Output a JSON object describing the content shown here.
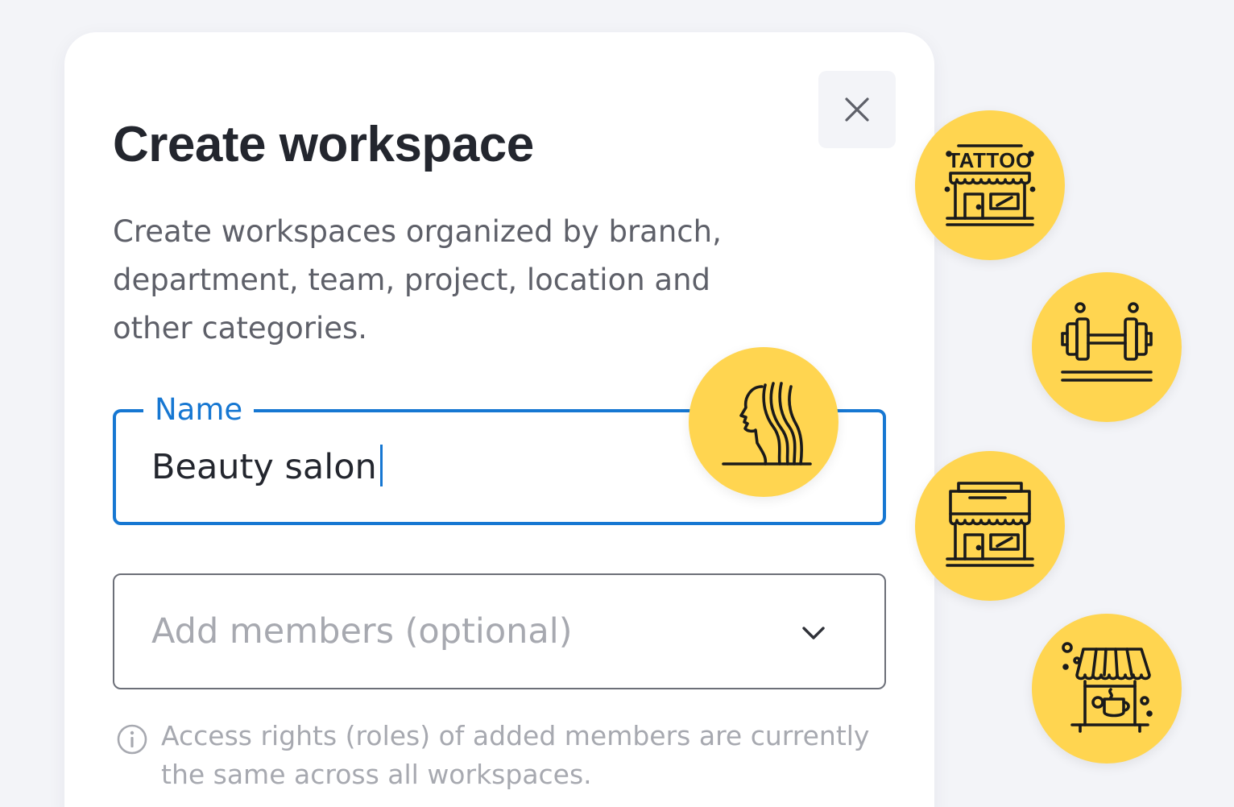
{
  "modal": {
    "title": "Create workspace",
    "description": "Create workspaces organized by branch, department, team, project, location and other categories.",
    "close_icon": "close-icon"
  },
  "name_field": {
    "label": "Name",
    "value": "Beauty salon",
    "focused": true
  },
  "members_field": {
    "placeholder": "Add members (optional)",
    "icon": "chevron-down-icon"
  },
  "hint": {
    "icon": "info-icon",
    "text": "Access rights (roles) of added members are currently the same across all workspaces."
  },
  "category_icons": {
    "tattoo_label": "TATTOO",
    "items": [
      "beauty-salon-icon",
      "tattoo-shop-icon",
      "gym-dumbbell-icon",
      "store-icon",
      "cafe-icon"
    ]
  },
  "colors": {
    "accent": "#1677D2",
    "bubble": "#FFD550",
    "title": "#23262E",
    "muted": "#A7A9B0",
    "background": "#F3F4F8"
  }
}
